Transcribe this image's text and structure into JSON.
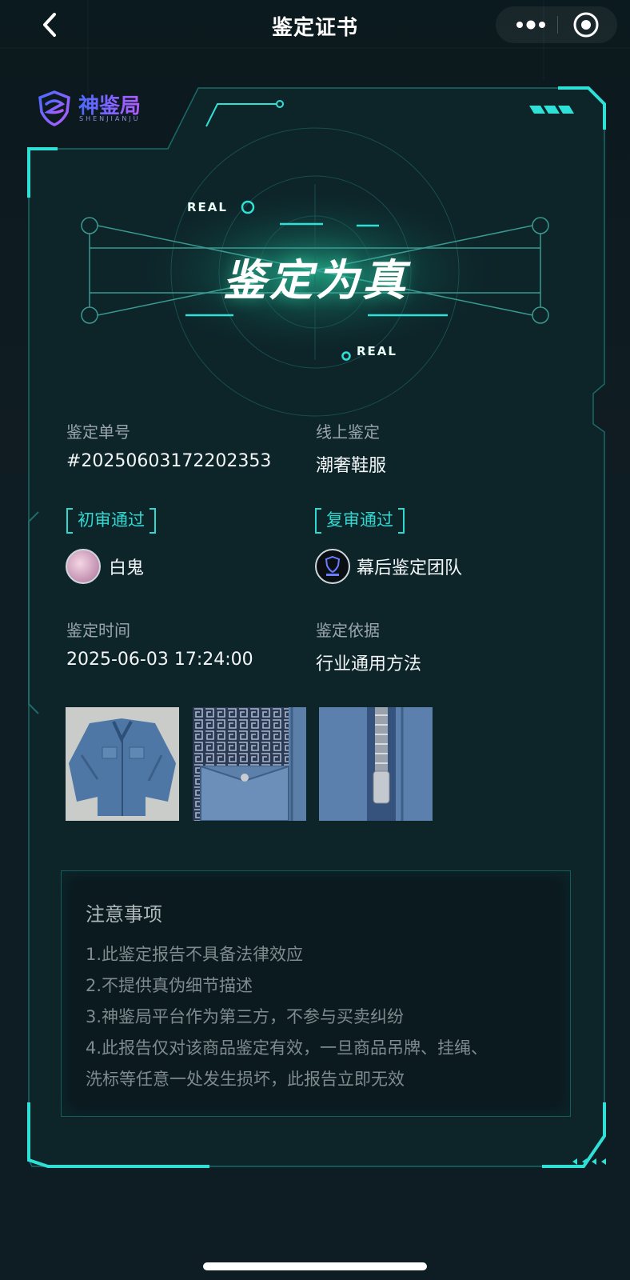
{
  "nav": {
    "title": "鉴定证书",
    "back_icon": "chevron-left-icon",
    "more_icon": "more-dots-icon",
    "close_icon": "target-circle-icon"
  },
  "brand": {
    "name": "神鉴局",
    "subtitle": "SHENJIANJU"
  },
  "hero": {
    "result": "鉴定为真",
    "tag_top": "REAL",
    "tag_bottom": "REAL"
  },
  "details": {
    "order_label": "鉴定单号",
    "order_value": "#20250603172202353",
    "type_label": "线上鉴定",
    "type_value": "潮奢鞋服",
    "first_review_tag": "初审通过",
    "first_reviewer": "白鬼",
    "second_review_tag": "复审通过",
    "second_reviewer": "幕后鉴定团队",
    "time_label": "鉴定时间",
    "time_value": "2025-06-03 17:24:00",
    "basis_label": "鉴定依据",
    "basis_value": "行业通用方法"
  },
  "photos": [
    {
      "name": "jacket-front-photo"
    },
    {
      "name": "jacket-pocket-photo"
    },
    {
      "name": "jacket-zipper-photo"
    }
  ],
  "notice": {
    "title": "注意事项",
    "items": [
      "1.此鉴定报告不具备法律效应",
      "2.不提供真伪细节描述",
      "3.神鉴局平台作为第三方，不参与买卖纠纷",
      "4.此报告仅对该商品鉴定有效，一旦商品吊牌、挂绳、",
      "洗标等任意一处发生损坏，此报告立即无效"
    ]
  },
  "colors": {
    "accent": "#2fd9d2",
    "background": "#0e1d24",
    "card": "#0d2429"
  }
}
